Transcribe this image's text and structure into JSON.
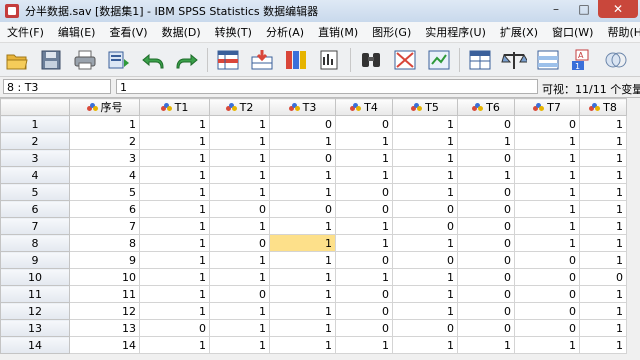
{
  "window": {
    "title": "分半数据.sav [数据集1] - IBM SPSS Statistics 数据编辑器"
  },
  "menu": [
    "文件(F)",
    "编辑(E)",
    "查看(V)",
    "数据(D)",
    "转换(T)",
    "分析(A)",
    "直销(M)",
    "图形(G)",
    "实用程序(U)",
    "扩展(X)",
    "窗口(W)",
    "帮助(H)"
  ],
  "cell_editor": {
    "ref": "8 : T3",
    "value": "1",
    "visible": "可视：11/11 个变量"
  },
  "columns": [
    "序号",
    "T1",
    "T2",
    "T3",
    "T4",
    "T5",
    "T6",
    "T7",
    "T8"
  ],
  "rows": [
    {
      "id": "1",
      "vals": [
        "1",
        "1",
        "1",
        "0",
        "0",
        "1",
        "0",
        "0",
        "1"
      ]
    },
    {
      "id": "2",
      "vals": [
        "2",
        "1",
        "1",
        "1",
        "1",
        "1",
        "1",
        "1",
        "1"
      ]
    },
    {
      "id": "3",
      "vals": [
        "3",
        "1",
        "1",
        "0",
        "1",
        "1",
        "0",
        "1",
        "1"
      ]
    },
    {
      "id": "4",
      "vals": [
        "4",
        "1",
        "1",
        "1",
        "1",
        "1",
        "1",
        "1",
        "1"
      ]
    },
    {
      "id": "5",
      "vals": [
        "5",
        "1",
        "1",
        "1",
        "0",
        "1",
        "0",
        "1",
        "1"
      ]
    },
    {
      "id": "6",
      "vals": [
        "6",
        "1",
        "0",
        "0",
        "0",
        "0",
        "0",
        "1",
        "1"
      ]
    },
    {
      "id": "7",
      "vals": [
        "7",
        "1",
        "1",
        "1",
        "1",
        "0",
        "0",
        "1",
        "1"
      ]
    },
    {
      "id": "8",
      "vals": [
        "8",
        "1",
        "0",
        "1",
        "1",
        "1",
        "0",
        "1",
        "1"
      ]
    },
    {
      "id": "9",
      "vals": [
        "9",
        "1",
        "1",
        "1",
        "0",
        "0",
        "0",
        "0",
        "1"
      ]
    },
    {
      "id": "10",
      "vals": [
        "10",
        "1",
        "1",
        "1",
        "1",
        "1",
        "0",
        "0",
        "0"
      ]
    },
    {
      "id": "11",
      "vals": [
        "11",
        "1",
        "0",
        "1",
        "0",
        "1",
        "0",
        "0",
        "1"
      ]
    },
    {
      "id": "12",
      "vals": [
        "12",
        "1",
        "1",
        "1",
        "0",
        "1",
        "0",
        "0",
        "1"
      ]
    },
    {
      "id": "13",
      "vals": [
        "13",
        "0",
        "1",
        "1",
        "0",
        "0",
        "0",
        "0",
        "1"
      ]
    },
    {
      "id": "14",
      "vals": [
        "14",
        "1",
        "1",
        "1",
        "1",
        "1",
        "1",
        "1",
        "1"
      ]
    }
  ],
  "selected": {
    "row": "8",
    "column": "T3"
  },
  "toolbar": [
    "open-icon",
    "save-icon",
    "print-icon",
    "recall-dialog-icon",
    "undo-icon",
    "redo-icon",
    "goto-case-icon",
    "goto-variable-icon",
    "variables-icon",
    "run-descriptives-icon",
    "find-icon",
    "insert-cases-icon",
    "insert-variable-icon",
    "split-file-icon",
    "weight-cases-icon",
    "select-cases-icon",
    "value-labels-icon",
    "use-sets-icon"
  ],
  "colors": {
    "selected_cell": "#fde08a",
    "title_bar": "#dfe9f5",
    "close_button": "#c9473b"
  }
}
